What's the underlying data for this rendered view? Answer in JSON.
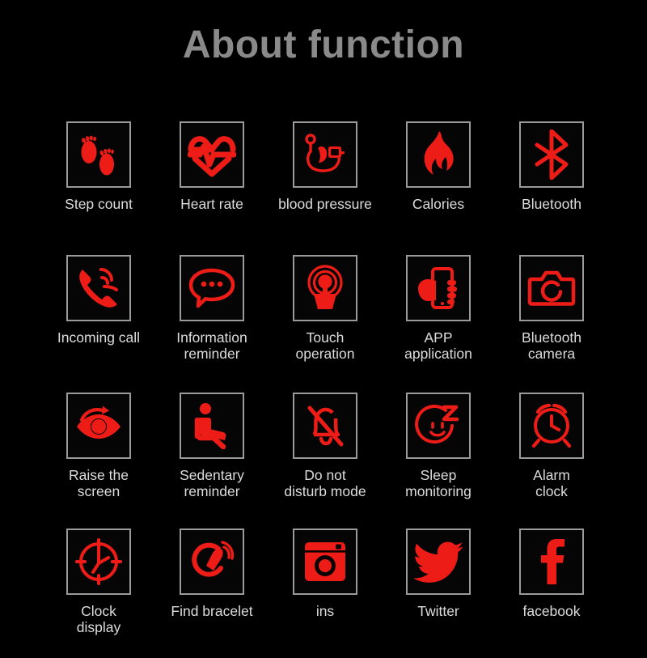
{
  "page": {
    "title": "About function",
    "background_color": "#000000",
    "title_color": "#8a8a8a",
    "icon_color": "#ee1c16",
    "label_color": "#dcdcdc",
    "icon_box_border_color": "#9a9a9a"
  },
  "rows": [
    {
      "items": [
        {
          "label": "Step count",
          "icon": "footprints-icon"
        },
        {
          "label": "Heart rate",
          "icon": "heart-pulse-icon"
        },
        {
          "label": "blood pressure",
          "icon": "blood-pressure-monitor-icon"
        },
        {
          "label": "Calories",
          "icon": "flame-icon"
        },
        {
          "label": "Bluetooth",
          "icon": "bluetooth-icon"
        }
      ]
    },
    {
      "items": [
        {
          "label": "Incoming call",
          "icon": "ringing-phone-icon"
        },
        {
          "label": "Information\nreminder",
          "icon": "speech-bubble-icon"
        },
        {
          "label": "Touch\noperation",
          "icon": "touch-tap-icon"
        },
        {
          "label": "APP\napplication",
          "icon": "hand-holding-phone-icon"
        },
        {
          "label": "Bluetooth\ncamera",
          "icon": "camera-icon"
        }
      ]
    },
    {
      "items": [
        {
          "label": "Raise the\nscreen",
          "icon": "eye-rotate-icon"
        },
        {
          "label": "Sedentary\nreminder",
          "icon": "seated-person-icon"
        },
        {
          "label": "Do not\ndisturb mode",
          "icon": "bell-slash-icon"
        },
        {
          "label": "Sleep\nmonitoring",
          "icon": "sleeping-face-icon"
        },
        {
          "label": "Alarm\nclock",
          "icon": "alarm-clock-icon"
        }
      ]
    },
    {
      "items": [
        {
          "label": "Clock\ndisplay",
          "icon": "clock-face-icon"
        },
        {
          "label": "Find bracelet",
          "icon": "bracelet-signal-icon"
        },
        {
          "label": "ins",
          "icon": "instagram-icon"
        },
        {
          "label": "Twitter",
          "icon": "twitter-bird-icon"
        },
        {
          "label": "facebook",
          "icon": "facebook-f-icon"
        }
      ]
    }
  ]
}
